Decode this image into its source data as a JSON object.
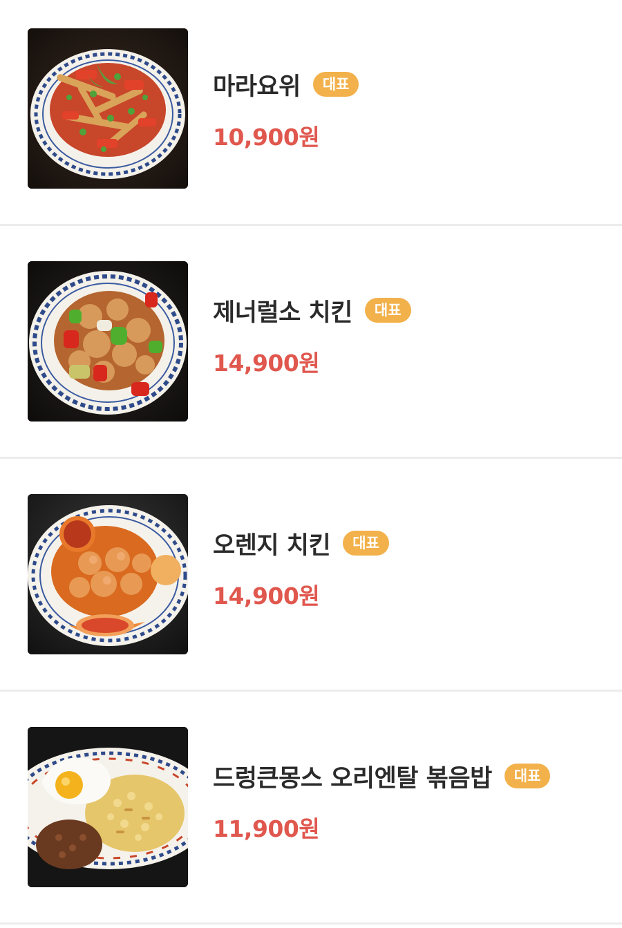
{
  "menu": {
    "items": [
      {
        "name": "마라요위",
        "badge": "대표",
        "price": "10,900원",
        "image": "dish-photo-mala-fish"
      },
      {
        "name": "제너럴소 치킨",
        "badge": "대표",
        "price": "14,900원",
        "image": "dish-photo-general-tso-chicken"
      },
      {
        "name": "오렌지 치킨",
        "badge": "대표",
        "price": "14,900원",
        "image": "dish-photo-orange-chicken"
      },
      {
        "name": "드렁큰몽스 오리엔탈 볶음밥",
        "badge": "대표",
        "price": "11,900원",
        "image": "dish-photo-fried-rice"
      }
    ]
  },
  "colors": {
    "price": "#e0574e",
    "badge_bg": "#f2b14b",
    "badge_text": "#ffffff",
    "divider": "#ececec",
    "name_text": "#2b2b2b"
  }
}
